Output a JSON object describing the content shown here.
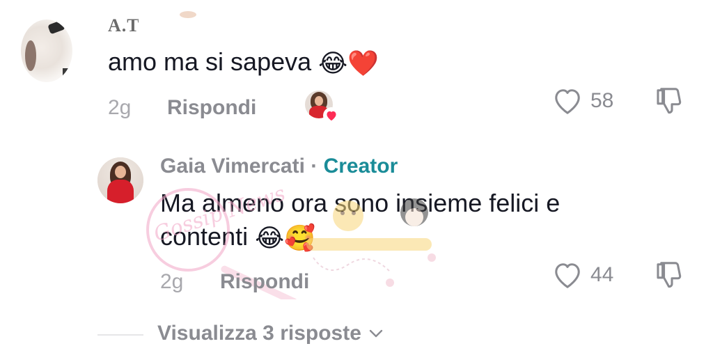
{
  "comment": {
    "username": "A.T",
    "text": "amo ma si sapeva",
    "emojis": [
      "😂",
      "❤️"
    ],
    "time": "2g",
    "reply_label": "Rispondi",
    "like_count": "58"
  },
  "reply": {
    "username": "Gaia Vimercati",
    "separator": " · ",
    "badge": "Creator",
    "text": "Ma almeno ora sono insieme felici e contenti",
    "emojis": [
      "😂",
      "🥰"
    ],
    "time": "2g",
    "reply_label": "Rispondi",
    "like_count": "44"
  },
  "view_replies": {
    "label": "Visualizza 3 risposte"
  },
  "watermark": {
    "text": "Gossip News"
  },
  "colors": {
    "text_primary": "#161823",
    "text_secondary": "#8a8b91",
    "text_muted": "#a8a8ad",
    "creator_accent": "#1a8c98",
    "heart_red": "#fe2c55"
  },
  "icons": {
    "like": "heart-outline-icon",
    "dislike": "thumbs-down-icon",
    "chevron": "chevron-down-icon",
    "liked_by_creator": "heart-badge-icon"
  }
}
